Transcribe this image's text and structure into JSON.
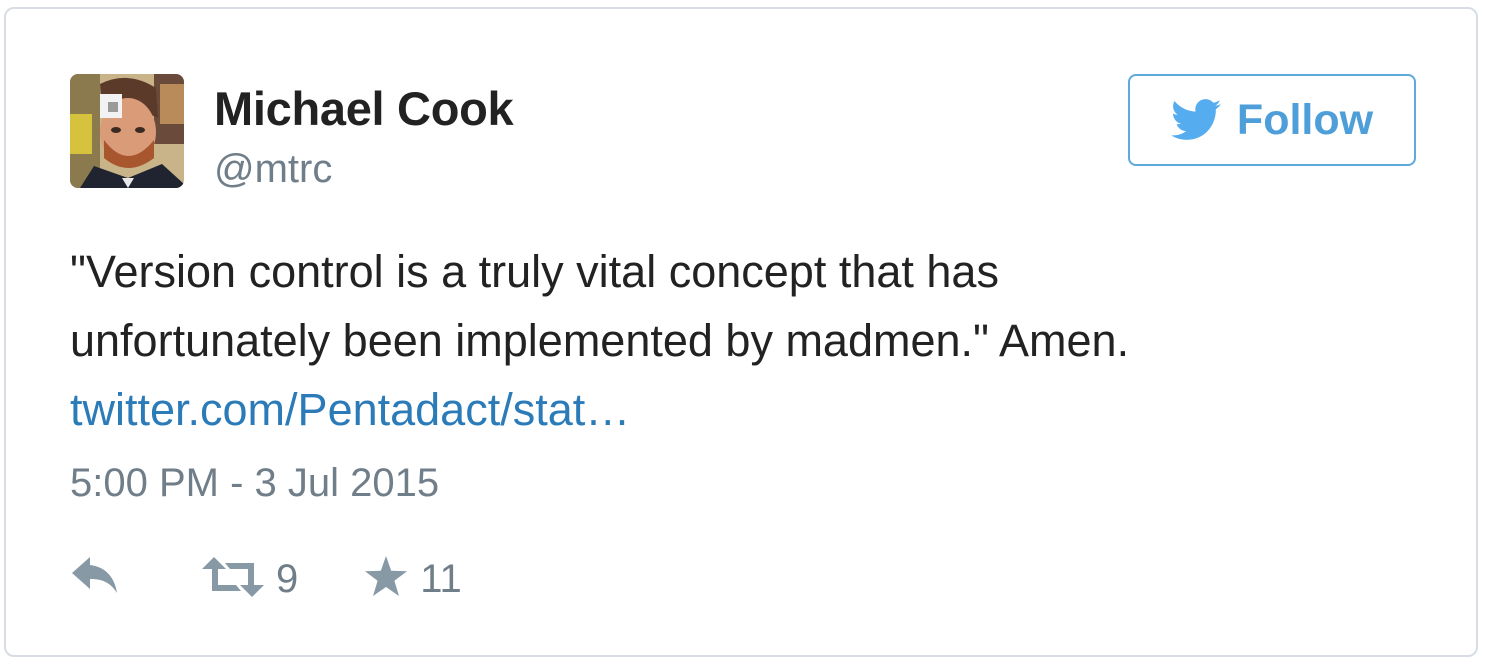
{
  "tweet": {
    "author": {
      "display_name": "Michael Cook",
      "handle": "@mtrc"
    },
    "follow_button": {
      "label": "Follow",
      "icon": "twitter-bird-icon"
    },
    "text_lines": [
      "\"Version control is a truly vital concept that has",
      "unfortunately been implemented by madmen.\" Amen."
    ],
    "link_text": "twitter.com/Pentadact/stat…",
    "timestamp": "5:00 PM - 3 Jul 2015",
    "actions": {
      "reply_icon": "reply-icon",
      "retweet_icon": "retweet-icon",
      "retweet_count": "9",
      "favorite_icon": "star-icon",
      "favorite_count": "11"
    },
    "colors": {
      "brand_blue": "#55acee",
      "link_blue": "#2b7bb9",
      "text": "#222222",
      "secondary_text": "#707e89",
      "border": "#d7dde3"
    }
  }
}
